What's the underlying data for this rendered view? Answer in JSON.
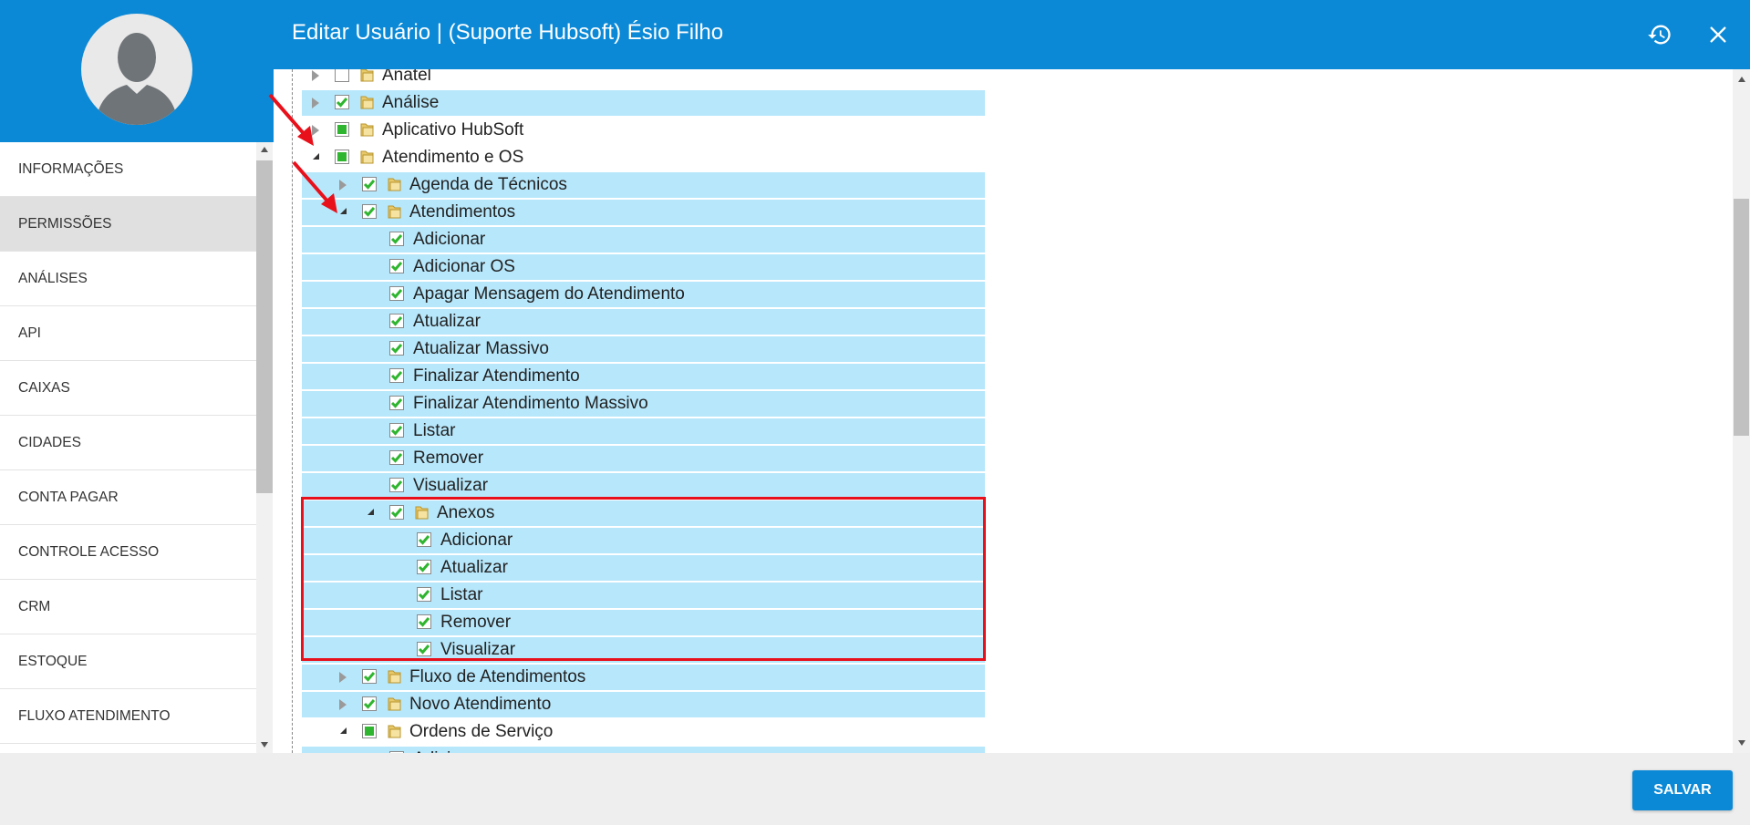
{
  "header": {
    "title": "Editar Usuário | (Suporte Hubsoft) Ésio Filho",
    "history_icon": "history-icon",
    "close_icon": "close-icon"
  },
  "sidebar": {
    "items": [
      {
        "label": "INFORMAÇÕES",
        "active": false
      },
      {
        "label": "PERMISSÕES",
        "active": true
      },
      {
        "label": "ANÁLISES",
        "active": false
      },
      {
        "label": "API",
        "active": false
      },
      {
        "label": "CAIXAS",
        "active": false
      },
      {
        "label": "CIDADES",
        "active": false
      },
      {
        "label": "CONTA PAGAR",
        "active": false
      },
      {
        "label": "CONTROLE ACESSO",
        "active": false
      },
      {
        "label": "CRM",
        "active": false
      },
      {
        "label": "ESTOQUE",
        "active": false
      },
      {
        "label": "FLUXO ATENDIMENTO",
        "active": false
      }
    ]
  },
  "tree": {
    "rows": [
      {
        "label": "Anatel",
        "level": 0,
        "folder": true,
        "toggle": "collapsed",
        "check": "none",
        "selected": false
      },
      {
        "label": "Análise",
        "level": 0,
        "folder": true,
        "toggle": "collapsed",
        "check": "checked",
        "selected": true
      },
      {
        "label": "Aplicativo HubSoft",
        "level": 0,
        "folder": true,
        "toggle": "collapsed",
        "check": "partial",
        "selected": false
      },
      {
        "label": "Atendimento e OS",
        "level": 0,
        "folder": true,
        "toggle": "expanded",
        "check": "partial",
        "selected": false
      },
      {
        "label": "Agenda de Técnicos",
        "level": 1,
        "folder": true,
        "toggle": "collapsed",
        "check": "checked",
        "selected": true
      },
      {
        "label": "Atendimentos",
        "level": 1,
        "folder": true,
        "toggle": "expanded",
        "check": "checked",
        "selected": true
      },
      {
        "label": "Adicionar",
        "level": 2,
        "folder": false,
        "toggle": "none",
        "check": "checked",
        "selected": true
      },
      {
        "label": "Adicionar OS",
        "level": 2,
        "folder": false,
        "toggle": "none",
        "check": "checked",
        "selected": true
      },
      {
        "label": "Apagar Mensagem do Atendimento",
        "level": 2,
        "folder": false,
        "toggle": "none",
        "check": "checked",
        "selected": true
      },
      {
        "label": "Atualizar",
        "level": 2,
        "folder": false,
        "toggle": "none",
        "check": "checked",
        "selected": true
      },
      {
        "label": "Atualizar Massivo",
        "level": 2,
        "folder": false,
        "toggle": "none",
        "check": "checked",
        "selected": true
      },
      {
        "label": "Finalizar Atendimento",
        "level": 2,
        "folder": false,
        "toggle": "none",
        "check": "checked",
        "selected": true
      },
      {
        "label": "Finalizar Atendimento Massivo",
        "level": 2,
        "folder": false,
        "toggle": "none",
        "check": "checked",
        "selected": true
      },
      {
        "label": "Listar",
        "level": 2,
        "folder": false,
        "toggle": "none",
        "check": "checked",
        "selected": true
      },
      {
        "label": "Remover",
        "level": 2,
        "folder": false,
        "toggle": "none",
        "check": "checked",
        "selected": true
      },
      {
        "label": "Visualizar",
        "level": 2,
        "folder": false,
        "toggle": "none",
        "check": "checked",
        "selected": true
      },
      {
        "label": "Anexos",
        "level": 2,
        "folder": true,
        "toggle": "expanded",
        "check": "checked",
        "selected": true
      },
      {
        "label": "Adicionar",
        "level": 3,
        "folder": false,
        "toggle": "none",
        "check": "checked",
        "selected": true
      },
      {
        "label": "Atualizar",
        "level": 3,
        "folder": false,
        "toggle": "none",
        "check": "checked",
        "selected": true
      },
      {
        "label": "Listar",
        "level": 3,
        "folder": false,
        "toggle": "none",
        "check": "checked",
        "selected": true
      },
      {
        "label": "Remover",
        "level": 3,
        "folder": false,
        "toggle": "none",
        "check": "checked",
        "selected": true
      },
      {
        "label": "Visualizar",
        "level": 3,
        "folder": false,
        "toggle": "none",
        "check": "checked",
        "selected": true
      },
      {
        "label": "Fluxo de Atendimentos",
        "level": 1,
        "folder": true,
        "toggle": "collapsed",
        "check": "checked",
        "selected": true
      },
      {
        "label": "Novo Atendimento",
        "level": 1,
        "folder": true,
        "toggle": "collapsed",
        "check": "checked",
        "selected": true
      },
      {
        "label": "Ordens de Serviço",
        "level": 1,
        "folder": true,
        "toggle": "expanded",
        "check": "partial",
        "selected": false
      },
      {
        "label": "Adicionar",
        "level": 2,
        "folder": false,
        "toggle": "none",
        "check": "checked",
        "selected": true
      }
    ]
  },
  "footer": {
    "save_label": "SALVAR"
  },
  "colors": {
    "primary": "#0b89d6",
    "selected_row": "#b7e7fb",
    "highlight": "#e8101a",
    "check": "#2fb52f"
  }
}
